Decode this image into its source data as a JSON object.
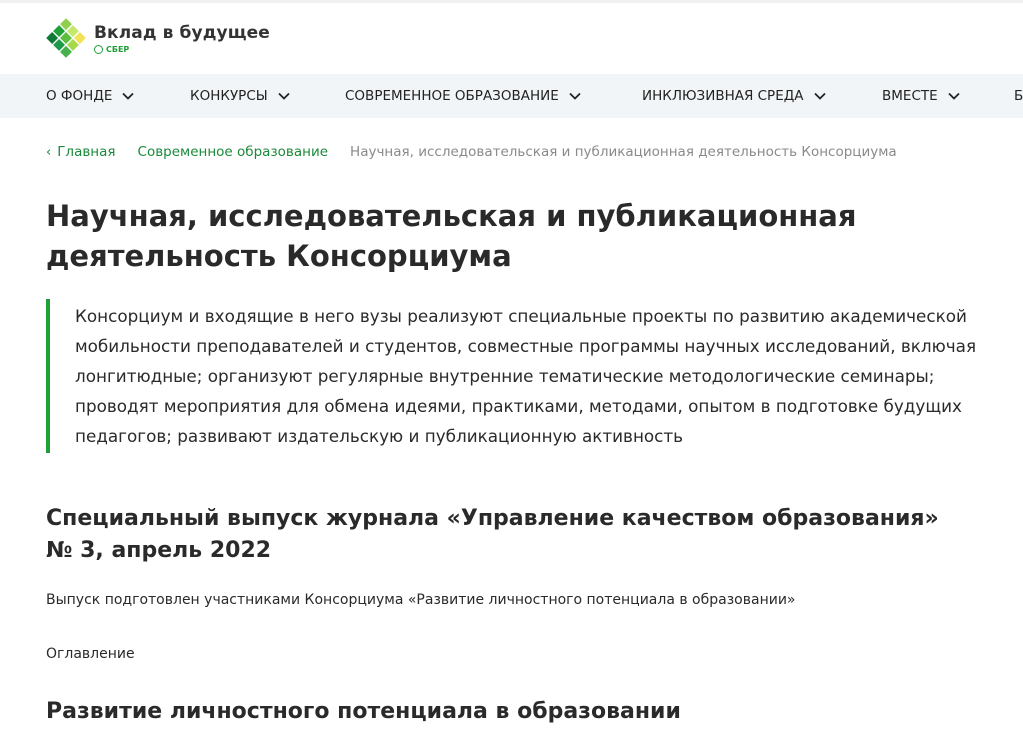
{
  "header": {
    "logo_title": "Вклад в будущее",
    "logo_sub": "СБЕР"
  },
  "nav": {
    "items": [
      {
        "label": "О ФОНДЕ"
      },
      {
        "label": "КОНКУРСЫ"
      },
      {
        "label": "СОВРЕМЕННОЕ ОБРАЗОВАНИЕ"
      },
      {
        "label": "ИНКЛЮЗИВНАЯ СРЕДА"
      },
      {
        "label": "ВМЕСТЕ"
      },
      {
        "label": "Б"
      }
    ]
  },
  "breadcrumb": {
    "home": "Главная",
    "parent": "Современное образование",
    "current": "Научная, исследовательская и публикационная деятельность Консорциума"
  },
  "page": {
    "title": "Научная, исследовательская и публикационная деятельность Консорциума",
    "intro": "Консорциум и входящие в него вузы реализуют специальные проекты по развитию академической мобильности преподавателей и студентов, совместные программы научных исследований, включая лонгитюдные; организуют регулярные внутренние тематические методологические семинары; проводят мероприятия для обмена идеями, практиками, методами, опытом в подготовке будущих педагогов; развивают издательскую и публикационную активность",
    "section_title_line1": "Специальный выпуск журнала «Управление качеством образования»",
    "section_title_line2": "№ 3, апрель 2022",
    "subtitle": "Выпуск подготовлен участниками Консорциума «Развитие личностного потенциала в образовании»",
    "toc_label": "Оглавление",
    "section2_title": "Развитие личностного потенциала в образовании"
  },
  "colors": {
    "brand_green": "#21a038",
    "link_green": "#1b8a3a",
    "nav_bg": "#f2f5f7"
  }
}
